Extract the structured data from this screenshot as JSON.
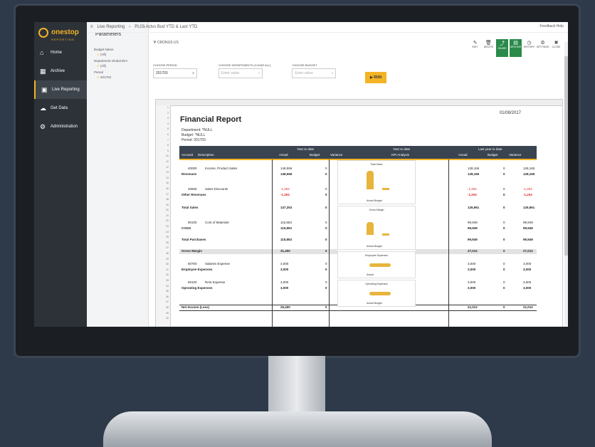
{
  "app": {
    "logo": "onestop",
    "logo_sub": "REPORTING"
  },
  "nav": [
    {
      "label": "Home",
      "icon": "home-icon"
    },
    {
      "label": "Archive",
      "icon": "archive-icon"
    },
    {
      "label": "Live Reporting",
      "icon": "report-icon"
    },
    {
      "label": "Get Data",
      "icon": "cloud-icon"
    },
    {
      "label": "Administration",
      "icon": "gear-icon"
    }
  ],
  "topbar": {
    "breadcrumb_root": "Live Reporting",
    "breadcrumb_page": "PL03 Actvs Bud YTD & Last YTD",
    "tools": "Feedback   Help"
  },
  "params": {
    "title": "Parameters",
    "items": [
      {
        "label": "Budget Name",
        "value": "(All)"
      },
      {
        "label": "Department Global Dim",
        "value": "(All)"
      },
      {
        "label": "Period",
        "value": "201703"
      }
    ]
  },
  "company": {
    "line1": "CRONUS US",
    "line2": ""
  },
  "actions": [
    "EDIT",
    "DELETE",
    "SHARE",
    "ARCHIVE",
    "HISTORY",
    "SETTINGS",
    "CLOSE"
  ],
  "filters": [
    {
      "label": "CHOOSE PERIOD",
      "value": "201703",
      "placeholder": ""
    },
    {
      "label": "CHOOSE DEPARTMENTS (CLEAR ALL)",
      "value": "",
      "placeholder": "Enter value"
    },
    {
      "label": "CHOOSE BUDGET",
      "value": "",
      "placeholder": "Enter value"
    }
  ],
  "run_label": "▶ RUN",
  "report": {
    "title": "Financial Report",
    "date": "01/08/2017",
    "department": "Department:  *NULL",
    "budget": "Budget:       *NULL",
    "period": "Period:        201703",
    "hdr": {
      "account": "Account",
      "desc": "Description",
      "ytd": "Year to date",
      "actual": "Actual",
      "budget": "Budget",
      "variance": "Variance",
      "kpi_ytd": "Year to date",
      "kpi": "KPI Analysis",
      "lytd": "Last year to date",
      "l_actual": "Actual",
      "l_budget": "Budget",
      "l_variance": "Variance"
    },
    "rows": [
      {
        "acc": "40000",
        "desc": "Income, Product Sales",
        "a": "148,556",
        "b": "0",
        "l_a": "128,165",
        "l_b": "0",
        "l_v": "128,165",
        "bold": false,
        "neg": false
      },
      {
        "acc": "",
        "desc": "Revenues",
        "a": "148,556",
        "b": "0",
        "l_a": "128,165",
        "l_b": "0",
        "l_v": "128,165",
        "bold": true,
        "neg": false
      },
      {
        "acc": "40600",
        "desc": "Sales Discounts",
        "a": "-1,304",
        "b": "0",
        "l_a": "-1,204",
        "l_b": "0",
        "l_v": "-1,204",
        "bold": false,
        "neg": true
      },
      {
        "acc": "",
        "desc": "Other Revenues",
        "a": "-1,304",
        "b": "0",
        "l_a": "-1,204",
        "l_b": "0",
        "l_v": "-1,204",
        "bold": true,
        "neg": true
      },
      {
        "acc": "",
        "desc": "Total Sales",
        "a": "147,253",
        "b": "0",
        "l_a": "126,961",
        "l_b": "0",
        "l_v": "126,961",
        "bold": true,
        "neg": false
      },
      {
        "acc": "50100",
        "desc": "Cost of Materials",
        "a": "115,853",
        "b": "0",
        "l_a": "99,949",
        "l_b": "0",
        "l_v": "99,949",
        "bold": false,
        "neg": false
      },
      {
        "acc": "",
        "desc": "COGS",
        "a": "115,853",
        "b": "0",
        "l_a": "99,949",
        "l_b": "0",
        "l_v": "99,949",
        "bold": true,
        "neg": false
      },
      {
        "acc": "",
        "desc": "Total Purchases",
        "a": "115,853",
        "b": "0",
        "l_a": "99,949",
        "l_b": "0",
        "l_v": "99,949",
        "bold": true,
        "neg": false
      },
      {
        "acc": "",
        "desc": "Gross Margin",
        "a": "31,400",
        "b": "0",
        "l_a": "27,012",
        "l_b": "0",
        "l_v": "27,012",
        "bold": true,
        "neg": false
      },
      {
        "acc": "60700",
        "desc": "Salaries Expense",
        "a": "3,000",
        "b": "0",
        "l_a": "3,000",
        "l_b": "0",
        "l_v": "3,000",
        "bold": false,
        "neg": false
      },
      {
        "acc": "",
        "desc": "Employee Expenses",
        "a": "3,000",
        "b": "0",
        "l_a": "3,000",
        "l_b": "0",
        "l_v": "3,000",
        "bold": true,
        "neg": false
      },
      {
        "acc": "60100",
        "desc": "Rent Expense",
        "a": "3,000",
        "b": "0",
        "l_a": "3,000",
        "l_b": "0",
        "l_v": "3,000",
        "bold": false,
        "neg": false
      },
      {
        "acc": "",
        "desc": "Operating Expenses",
        "a": "3,000",
        "b": "0",
        "l_a": "3,000",
        "l_b": "0",
        "l_v": "3,000",
        "bold": true,
        "neg": false
      },
      {
        "acc": "",
        "desc": "Net Income (Loss)",
        "a": "25,400",
        "b": "0",
        "l_a": "21,012",
        "l_b": "0",
        "l_v": "21,012",
        "bold": true,
        "neg": false
      }
    ],
    "kpi": [
      {
        "title": "Total Sales",
        "legend": "Actual   Budget"
      },
      {
        "title": "Gross Margin",
        "legend": "Actual   Budget"
      },
      {
        "title": "Employee Expenses",
        "legend": "Actual"
      },
      {
        "title": "Operating Expenses",
        "legend": "Actual   Budget"
      }
    ]
  }
}
